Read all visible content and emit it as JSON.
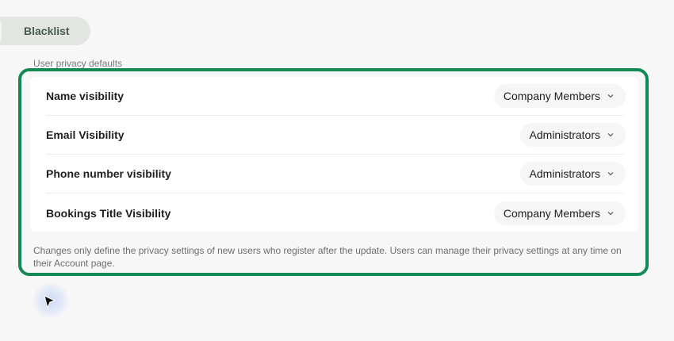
{
  "tabs": {
    "active_label": "Blacklist"
  },
  "section": {
    "label": "User privacy defaults"
  },
  "settings": [
    {
      "label": "Name visibility",
      "value": "Company Members"
    },
    {
      "label": "Email Visibility",
      "value": "Administrators"
    },
    {
      "label": "Phone number visibility",
      "value": "Administrators"
    },
    {
      "label": "Bookings Title Visibility",
      "value": "Company Members"
    }
  ],
  "note": "Changes only define the privacy settings of new users who register after the update. Users can manage their privacy settings at any time on their Account page.",
  "colors": {
    "highlight": "#138a55",
    "background": "#f7f7f7"
  },
  "icons": {
    "select_chevron": "chevron-down-icon",
    "pointer": "mouse-pointer-icon"
  }
}
